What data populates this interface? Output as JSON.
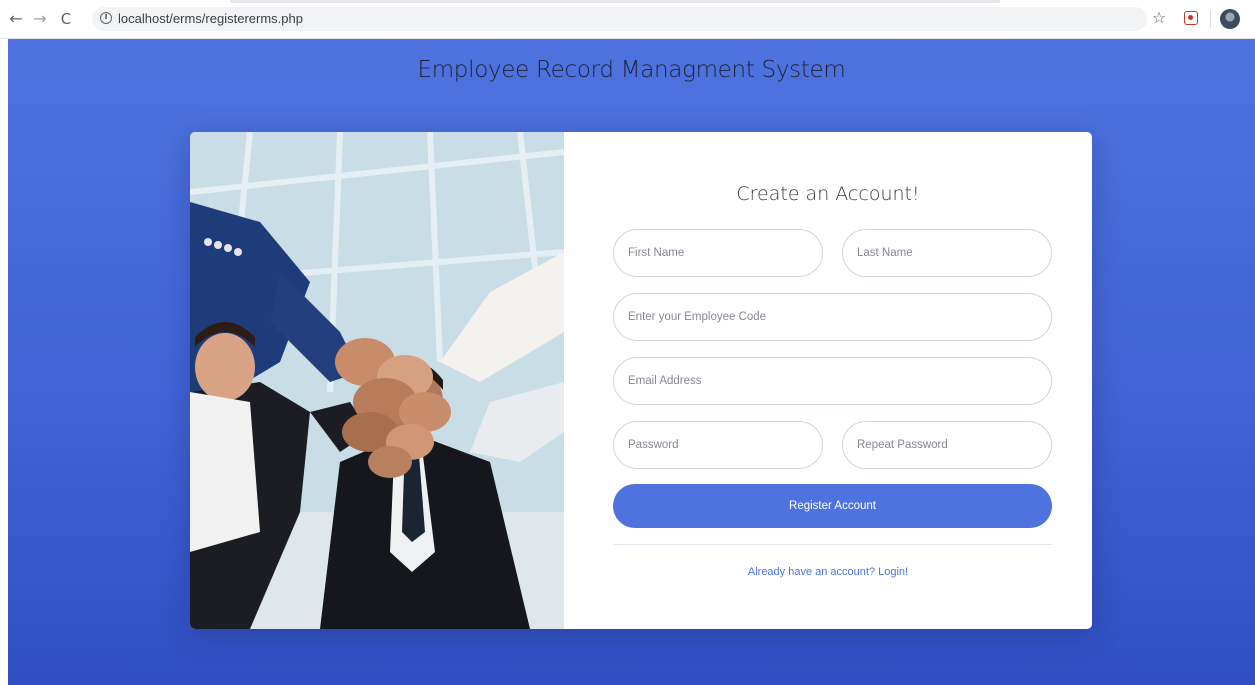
{
  "browser": {
    "url": "localhost/erms/registererms.php",
    "back_icon": "←",
    "forward_icon": "→",
    "reload_icon": "C",
    "info_icon": "i",
    "star_icon": "☆"
  },
  "page": {
    "title": "Employee Record Managment System"
  },
  "form": {
    "heading": "Create an Account!",
    "first_name_placeholder": "First Name",
    "last_name_placeholder": "Last Name",
    "employee_code_placeholder": "Enter your Employee Code",
    "email_placeholder": "Email Address",
    "password_placeholder": "Password",
    "repeat_password_placeholder": "Repeat Password",
    "register_label": "Register Account",
    "login_link": "Already have an account? Login!"
  },
  "colors": {
    "primary": "#4e73df",
    "background": "#3f61d4",
    "card": "#ffffff"
  }
}
